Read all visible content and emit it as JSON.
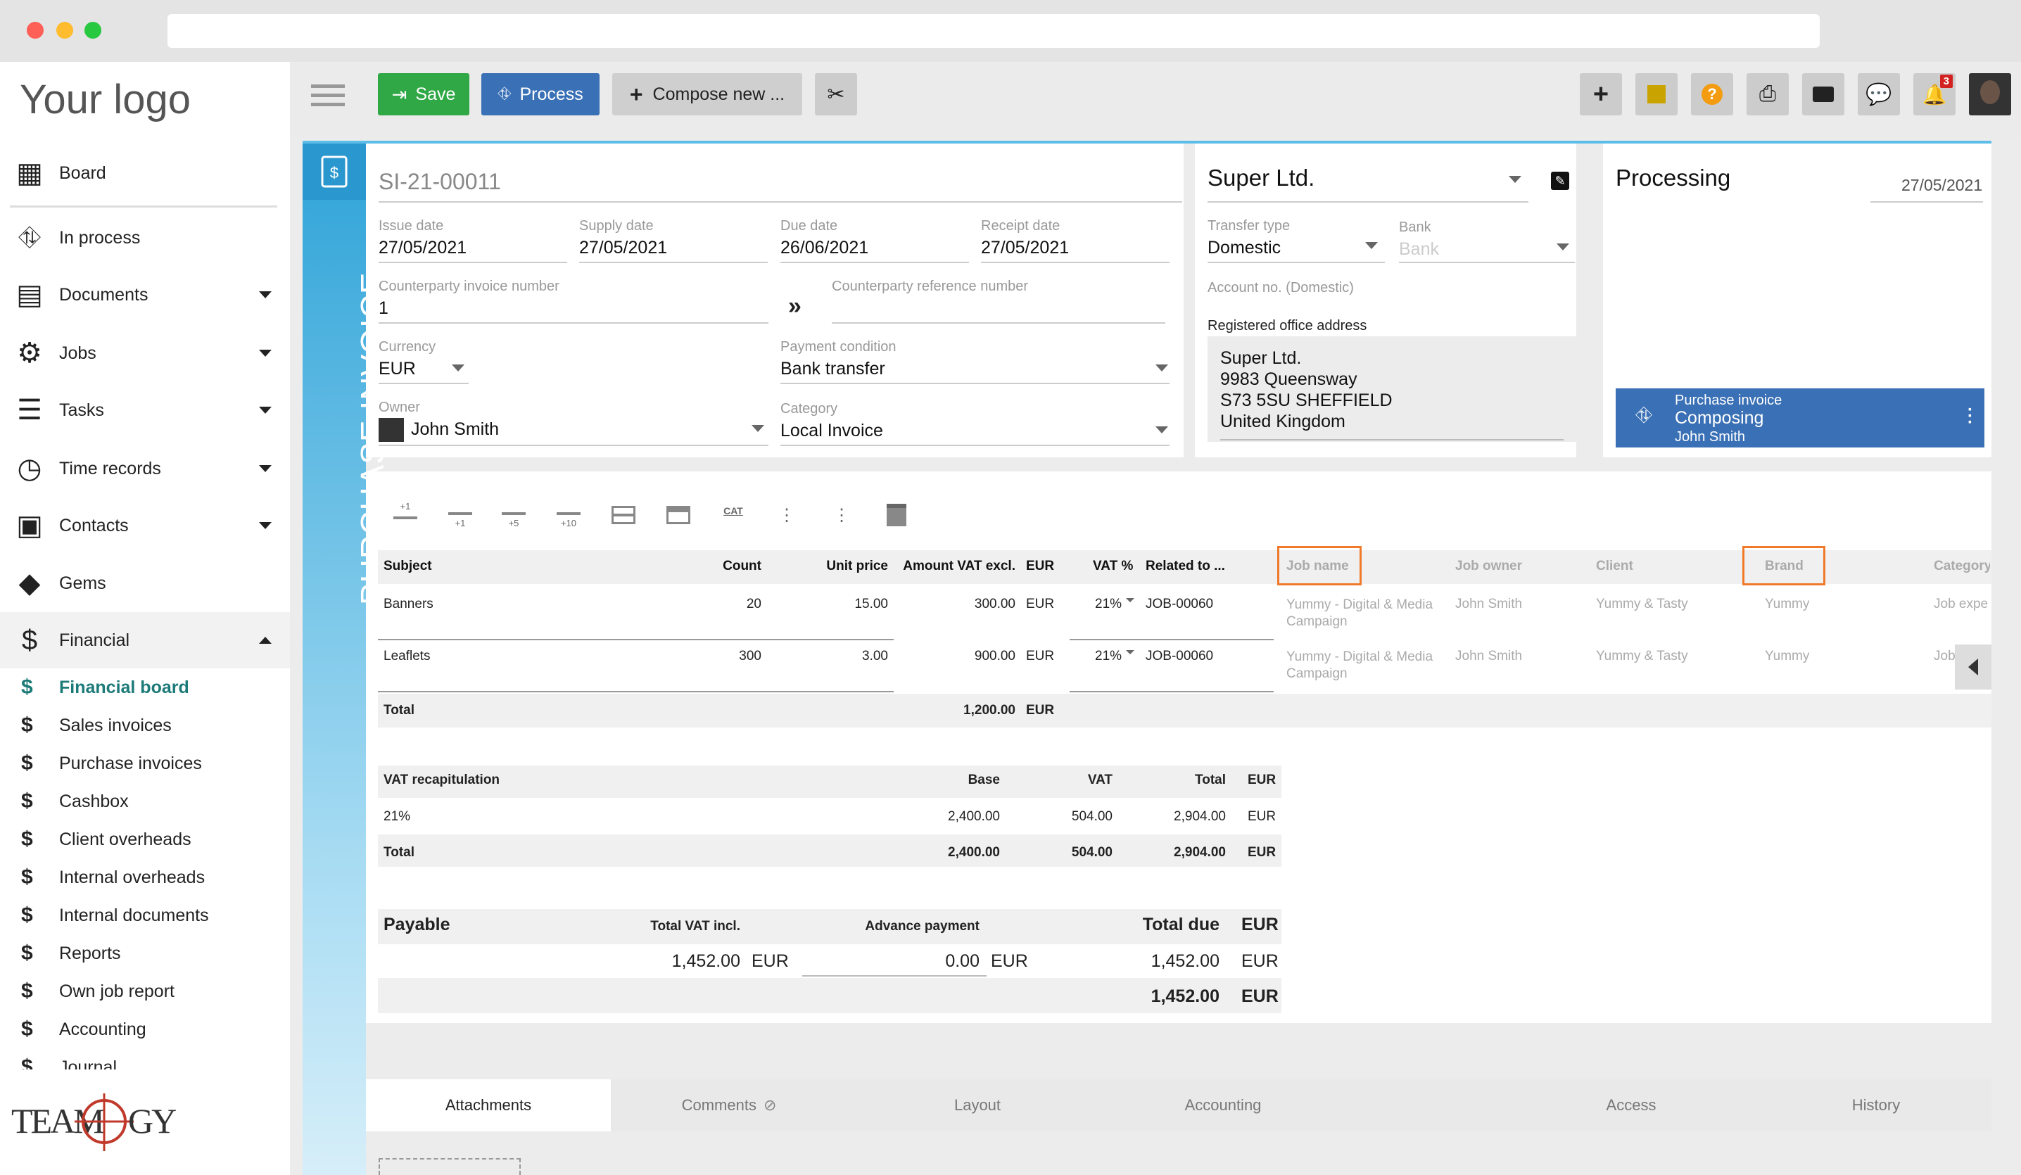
{
  "app": {
    "logo_text": "Your logo",
    "brand_logo": "TEAMOGY"
  },
  "toolbar": {
    "save_label": "Save",
    "process_label": "Process",
    "compose_label": "Compose new ...",
    "notifications_count": "3"
  },
  "sidebar": {
    "items": [
      {
        "label": "Board",
        "icon": "grid-icon"
      },
      {
        "label": "In process",
        "icon": "process-icon"
      },
      {
        "label": "Documents",
        "icon": "document-icon"
      },
      {
        "label": "Jobs",
        "icon": "gears-icon"
      },
      {
        "label": "Tasks",
        "icon": "tasks-icon"
      },
      {
        "label": "Time records",
        "icon": "clock-icon"
      },
      {
        "label": "Contacts",
        "icon": "contacts-icon"
      },
      {
        "label": "Gems",
        "icon": "gem-icon"
      },
      {
        "label": "Financial",
        "icon": "dollar-icon"
      }
    ],
    "financial_sub": [
      "Financial board",
      "Sales invoices",
      "Purchase invoices",
      "Cashbox",
      "Client overheads",
      "Internal overheads",
      "Internal documents",
      "Reports",
      "Own job report",
      "Accounting",
      "Journal"
    ]
  },
  "document": {
    "vertical_title": "PURCHASE INVOICE",
    "number": "SI-21-00011",
    "issue_date_label": "Issue date",
    "issue_date": "27/05/2021",
    "supply_date_label": "Supply date",
    "supply_date": "27/05/2021",
    "due_date_label": "Due date",
    "due_date": "26/06/2021",
    "receipt_date_label": "Receipt date",
    "receipt_date": "27/05/2021",
    "cp_invoice_label": "Counterparty invoice number",
    "cp_invoice": "1",
    "cp_reference_label": "Counterparty reference number",
    "currency_label": "Currency",
    "currency": "EUR",
    "payment_condition_label": "Payment condition",
    "payment_condition": "Bank transfer",
    "owner_label": "Owner",
    "owner": "John Smith",
    "category_label": "Category",
    "category": "Local Invoice"
  },
  "counterparty": {
    "name": "Super Ltd.",
    "transfer_type_label": "Transfer type",
    "transfer_type": "Domestic",
    "bank_label": "Bank",
    "bank_placeholder": "Bank",
    "account_label": "Account no. (Domestic)",
    "address_label": "Registered office address",
    "address_lines": [
      "Super Ltd.",
      "9983 Queensway",
      "S73 5SU SHEFFIELD",
      "United Kingdom"
    ]
  },
  "status": {
    "title": "Processing",
    "date": "27/05/2021",
    "workflow_type": "Purchase invoice",
    "workflow_state": "Composing",
    "workflow_user": "John Smith"
  },
  "line_tools": [
    "+1",
    "+1",
    "+5",
    "+10",
    "CAT"
  ],
  "lines": {
    "headers": [
      "Subject",
      "Count",
      "Unit price",
      "Amount VAT excl.",
      "EUR",
      "VAT %",
      "Related to ...",
      "Job name",
      "Job owner",
      "Client",
      "Brand",
      "Category"
    ],
    "rows": [
      {
        "subject": "Banners",
        "count": "20",
        "unit_price": "15.00",
        "amount": "300.00",
        "cur": "EUR",
        "vat": "21%",
        "related": "JOB-00060",
        "job_name": "Yummy - Digital & Media Campaign",
        "job_owner": "John Smith",
        "client": "Yummy & Tasty",
        "brand": "Yummy",
        "category": "Job expe"
      },
      {
        "subject": "Leaflets",
        "count": "300",
        "unit_price": "3.00",
        "amount": "900.00",
        "cur": "EUR",
        "vat": "21%",
        "related": "JOB-00060",
        "job_name": "Yummy - Digital & Media Campaign",
        "job_owner": "John Smith",
        "client": "Yummy & Tasty",
        "brand": "Yummy",
        "category": "Job exp"
      }
    ],
    "total_label": "Total",
    "total_amount": "1,200.00",
    "total_cur": "EUR"
  },
  "vat_recap": {
    "headers": [
      "VAT recapitulation",
      "Base",
      "VAT",
      "Total",
      "EUR"
    ],
    "rows": [
      {
        "rate": "21%",
        "base": "2,400.00",
        "vat": "504.00",
        "total": "2,904.00",
        "cur": "EUR"
      }
    ],
    "total": {
      "label": "Total",
      "base": "2,400.00",
      "vat": "504.00",
      "total": "2,904.00",
      "cur": "EUR"
    }
  },
  "payable": {
    "label": "Payable",
    "vat_incl_label": "Total VAT incl.",
    "advance_label": "Advance payment",
    "total_due_label": "Total due",
    "cur": "EUR",
    "vat_incl": "1,452.00",
    "advance": "0.00",
    "total_due": "1,452.00",
    "final": "1,452.00"
  },
  "tabs": [
    "Attachments",
    "Comments",
    "Layout",
    "Accounting",
    "Access",
    "History"
  ],
  "colors": {
    "save": "#2fa845",
    "process": "#3a70b5",
    "accent_teal": "#1c7a78",
    "workflow_blue": "#3a70b5",
    "highlight_orange": "#f07a2a",
    "vertical_bar": "#5bbde8"
  }
}
